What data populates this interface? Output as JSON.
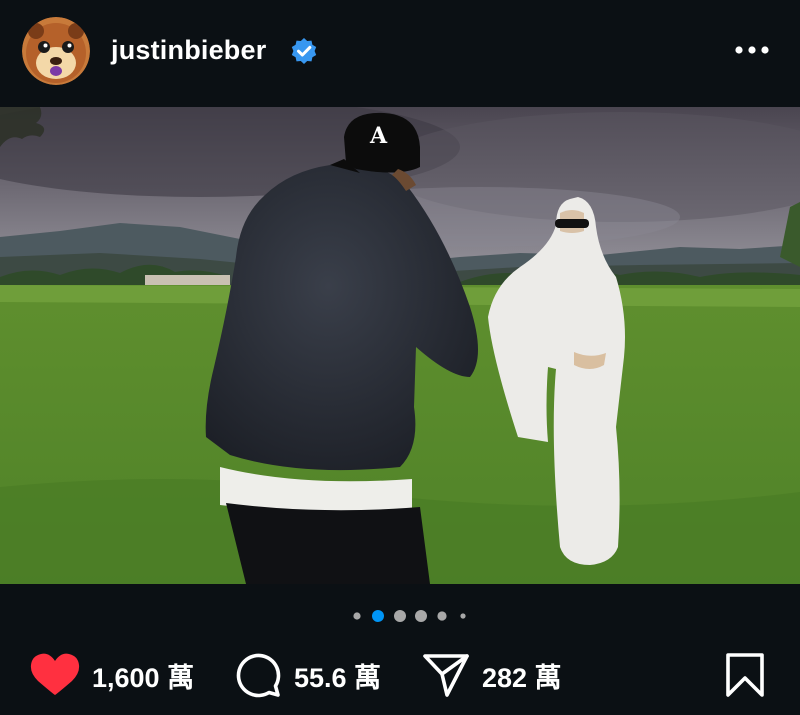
{
  "header": {
    "username": "justinbieber",
    "verified_badge_color": "#3897f0",
    "avatar_icon": "cartoon-bear-avatar",
    "more_icon": "more-horizontal-icon"
  },
  "photo": {
    "icon": "post-photo"
  },
  "carousel": {
    "total_dots": 6,
    "active_index": 1,
    "active_color": "#0095f6",
    "inactive_color": "#a8a8a8"
  },
  "actions": {
    "like_count": "1,600 萬",
    "comment_count": "55.6 萬",
    "share_count": "282 萬",
    "like_color": "#ff3040",
    "like_icon": "heart-filled-icon",
    "comment_icon": "comment-bubble-icon",
    "share_icon": "paper-plane-icon",
    "save_icon": "bookmark-icon"
  }
}
